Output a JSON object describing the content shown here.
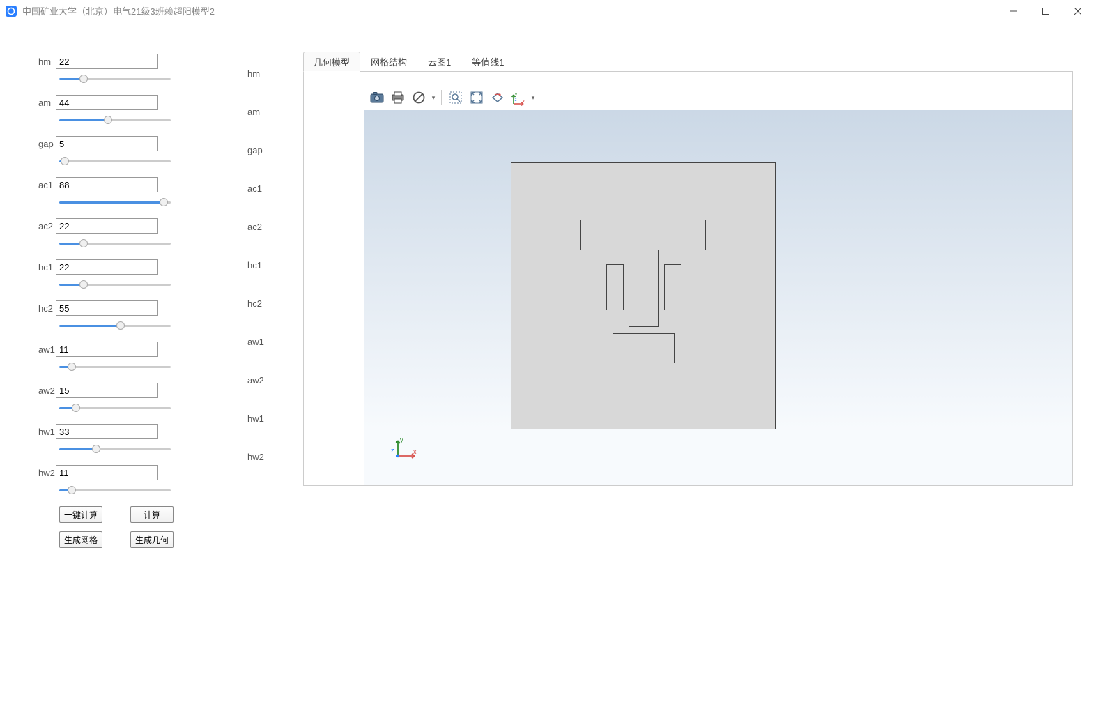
{
  "window": {
    "title": "中国矿业大学（北京）电气21级3班赖超阳模型2"
  },
  "params": [
    {
      "name": "hm",
      "value": "22",
      "pct": 22
    },
    {
      "name": "am",
      "value": "44",
      "pct": 44
    },
    {
      "name": "gap",
      "value": "5",
      "pct": 5
    },
    {
      "name": "ac1",
      "value": "88",
      "pct": 94
    },
    {
      "name": "ac2",
      "value": "22",
      "pct": 22
    },
    {
      "name": "hc1",
      "value": "22",
      "pct": 22
    },
    {
      "name": "hc2",
      "value": "55",
      "pct": 55
    },
    {
      "name": "aw1",
      "value": "11",
      "pct": 11
    },
    {
      "name": "aw2",
      "value": "15",
      "pct": 15
    },
    {
      "name": "hw1",
      "value": "33",
      "pct": 33
    },
    {
      "name": "hw2",
      "value": "11",
      "pct": 11
    }
  ],
  "buttons": {
    "oneKeyCalc": "一键计算",
    "calc": "计算",
    "genMesh": "生成网格",
    "genGeom": "生成几何"
  },
  "tabs": [
    "几何模型",
    "网格结构",
    "云图1",
    "等值线1"
  ],
  "active_tab": 0
}
